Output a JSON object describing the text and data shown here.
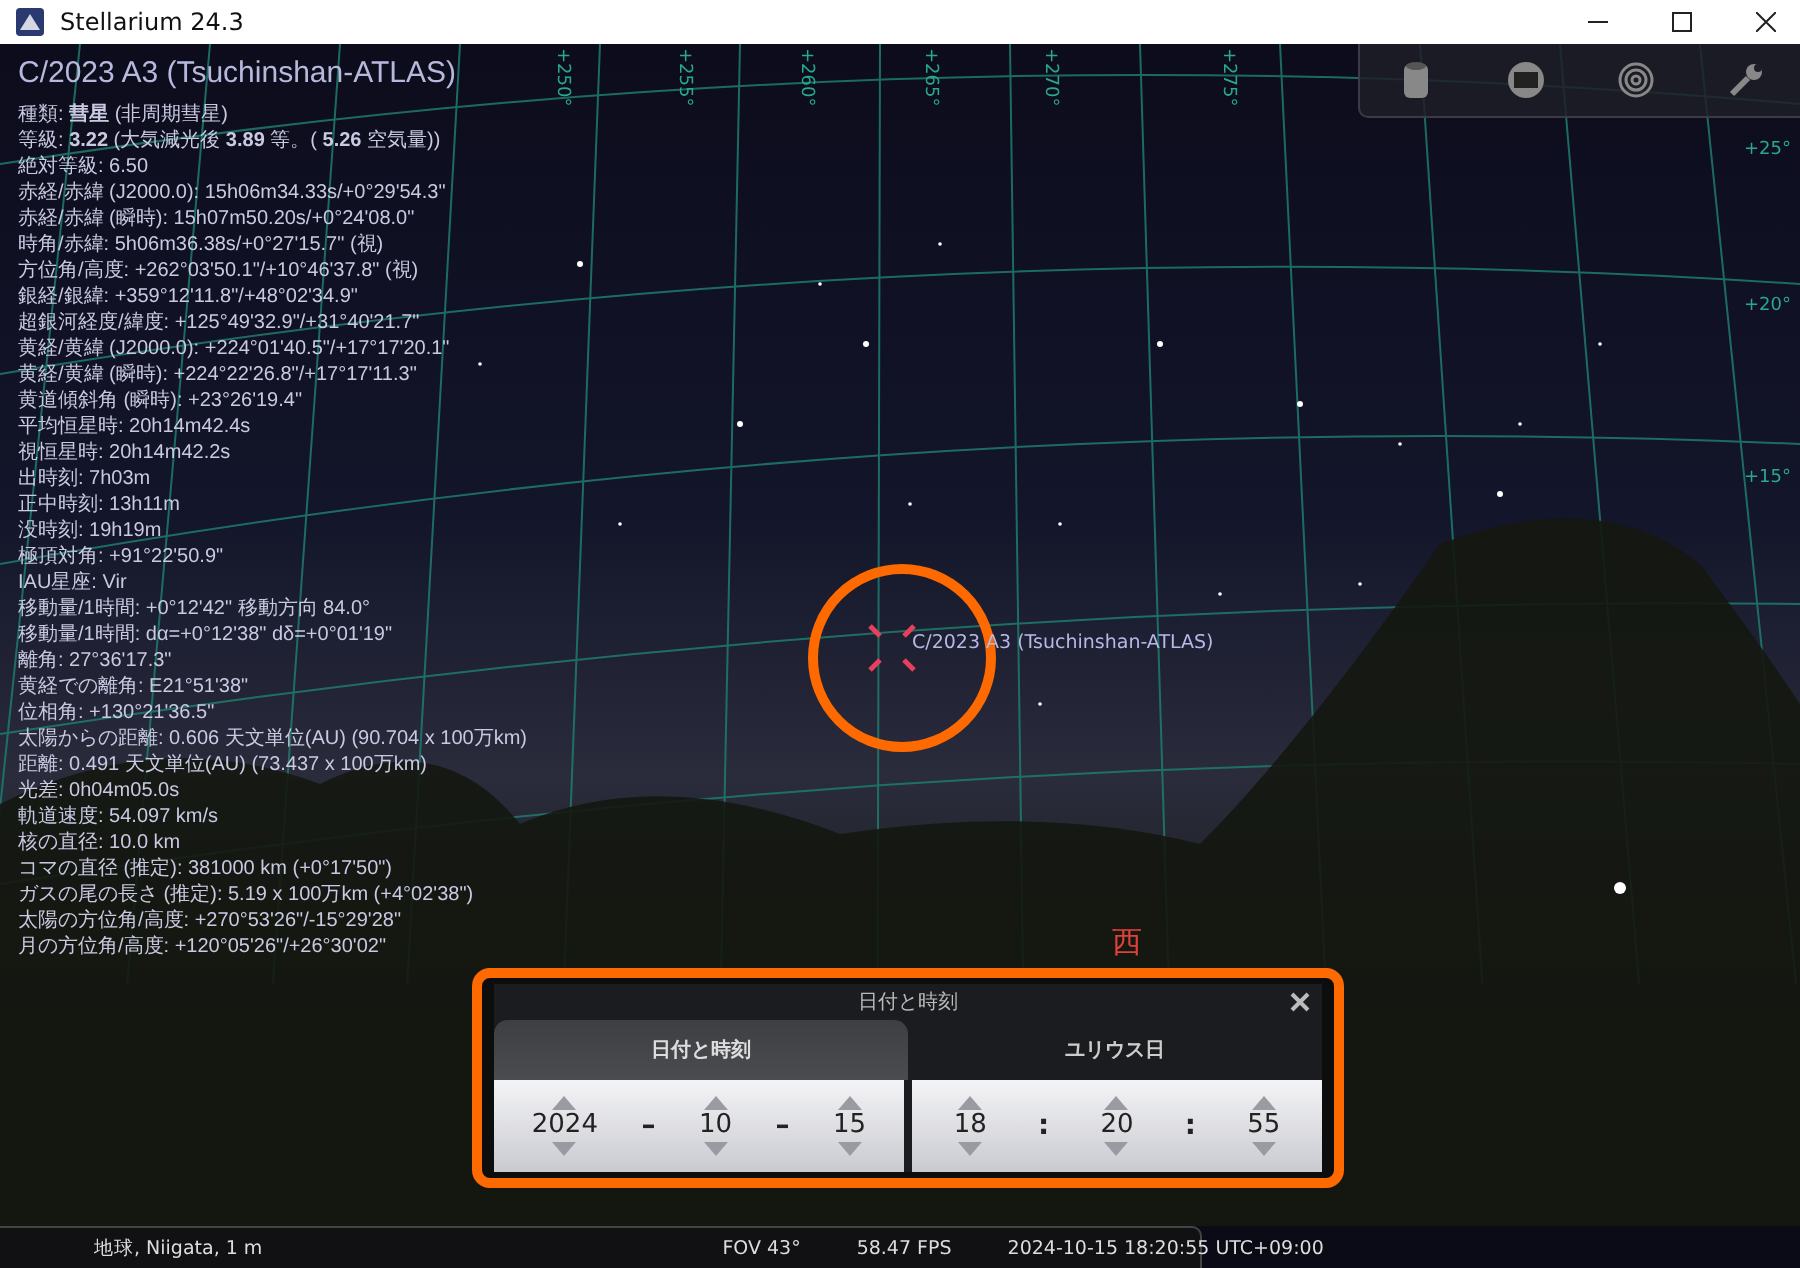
{
  "window": {
    "title": "Stellarium 24.3"
  },
  "object_title": "C/2023 A3 (Tsuchinshan-ATLAS)",
  "info_lines": [
    "種類: **彗星** (非周期彗星)",
    "等級: **3.22** (大気減光後 **3.89** 等。( **5.26** 空気量))",
    "絶対等級: 6.50",
    "赤経/赤緯 (J2000.0): 15h06m34.33s/+0°29'54.3\"",
    "赤経/赤緯 (瞬時): 15h07m50.20s/+0°24'08.0\"",
    "時角/赤緯: 5h06m36.38s/+0°27'15.7\" (視)",
    "方位角/高度: +262°03'50.1\"/+10°46'37.8\" (視)",
    "銀経/銀緯: +359°12'11.8\"/+48°02'34.9\"",
    "超銀河経度/緯度: +125°49'32.9\"/+31°40'21.7\"",
    "黄経/黄緯 (J2000.0): +224°01'40.5\"/+17°17'20.1\"",
    "黄経/黄緯 (瞬時): +224°22'26.8\"/+17°17'11.3\"",
    "黄道傾斜角 (瞬時): +23°26'19.4\"",
    "平均恒星時: 20h14m42.4s",
    "視恒星時: 20h14m42.2s",
    "出時刻: 7h03m",
    "正中時刻: 13h11m",
    "没時刻: 19h19m",
    "極頂対角: +91°22'50.9\"",
    "IAU星座: Vir",
    "移動量/1時間: +0°12'42\" 移動方向 84.0°",
    "移動量/1時間: dα=+0°12'38\" dδ=+0°01'19\"",
    "離角: 27°36'17.3\"",
    "黄経での離角: E21°51'38\"",
    "位相角: +130°21'36.5\"",
    "太陽からの距離: 0.606 天文単位(AU) (90.704 x 100万km)",
    "距離: 0.491 天文単位(AU) (73.437 x 100万km)",
    "光差: 0h04m05.0s",
    "軌道速度: 54.097 km/s",
    "核の直径: 10.0 km",
    "コマの直径 (推定): 381000 km (+0°17'50\")",
    "ガスの尾の長さ (推定): 5.19 x 100万km (+4°02'38\")",
    "太陽の方位角/高度: +270°53'26\"/-15°29'28\"",
    "月の方位角/高度: +120°05'26\"/+26°30'02\""
  ],
  "grid_labels": {
    "azimuth": [
      "+250°",
      "+255°",
      "+260°",
      "+265°",
      "+270°",
      "+275°"
    ],
    "altitude": [
      "+25°",
      "+20°",
      "+15°"
    ]
  },
  "target_label": "C/2023 A3 (Tsuchinshan-ATLAS)",
  "cardinal": "西",
  "dialog": {
    "title": "日付と時刻",
    "tabs": [
      {
        "label": "日付と時刻",
        "selected": true
      },
      {
        "label": "ユリウス日",
        "selected": false
      }
    ],
    "date": {
      "fields": [
        "2024",
        "10",
        "15"
      ],
      "separators": [
        "–",
        "–"
      ]
    },
    "time": {
      "fields": [
        "18",
        "20",
        "55"
      ],
      "separators": [
        ":",
        ":"
      ]
    }
  },
  "status_bar": {
    "location": "地球, Niigata, 1 m",
    "fov": "FOV 43°",
    "fps": "58.47 FPS",
    "datetime": "2024-10-15 18:20:55 UTC+09:00"
  }
}
